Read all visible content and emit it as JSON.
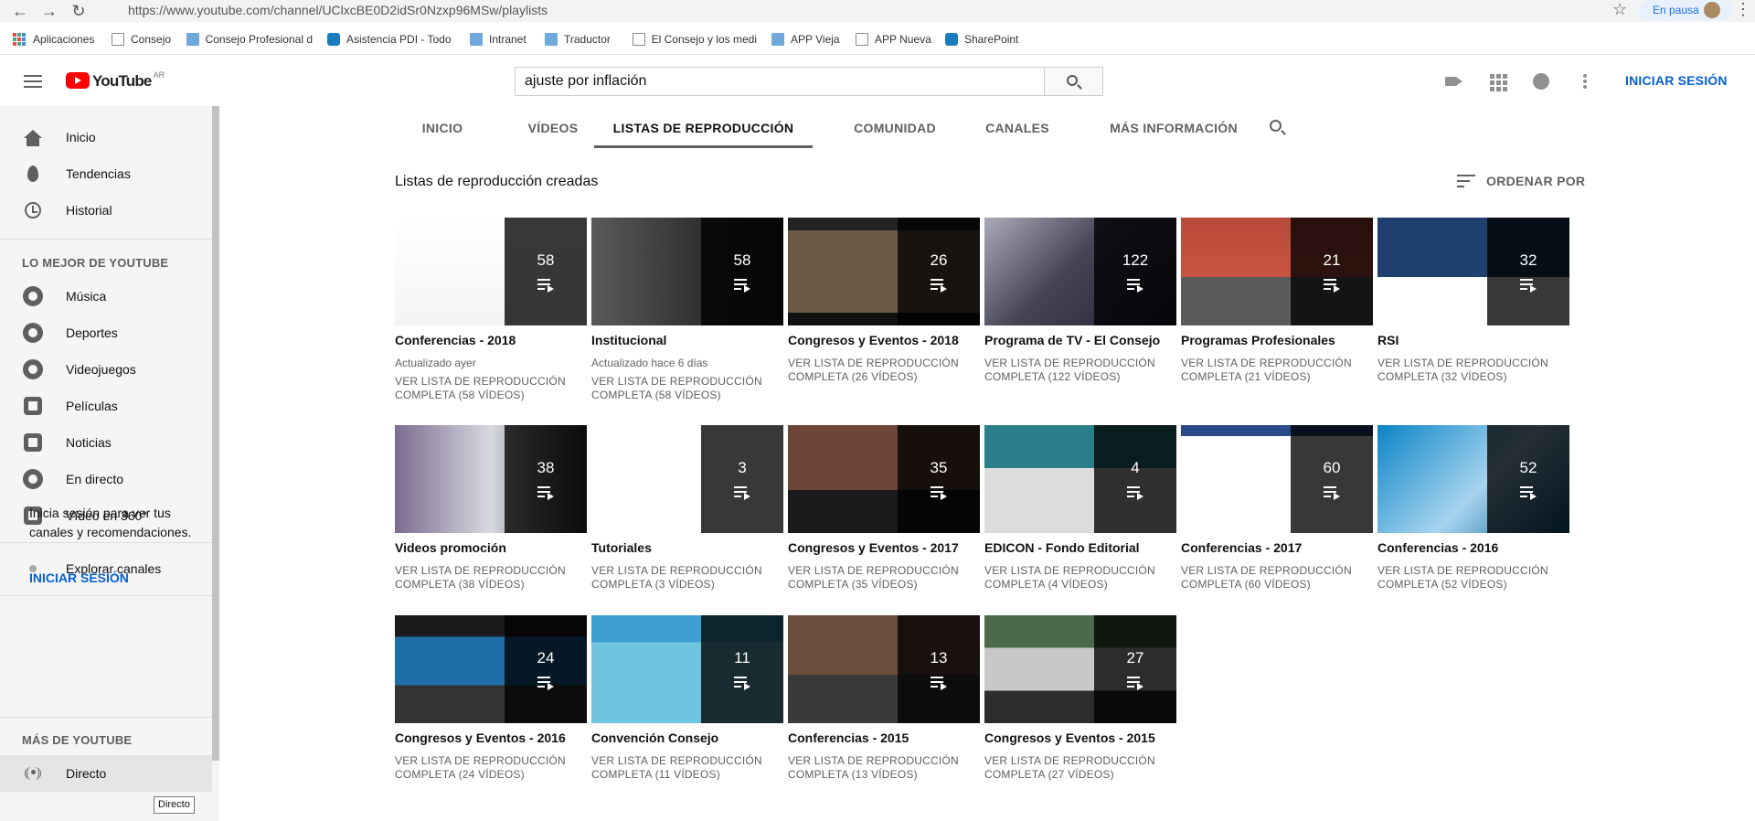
{
  "browser": {
    "url": "https://www.youtube.com/channel/UClxcBE0D2idSr0Nzxp96MSw/playlists",
    "paused_label": "En pausa",
    "bookmarks": [
      "Aplicaciones",
      "Consejo",
      "Consejo Profesional d",
      "Asistencia PDI - Todo",
      "Intranet",
      "Traductor",
      "El Consejo y los medi",
      "APP Vieja",
      "APP Nueva",
      "SharePoint"
    ]
  },
  "masthead": {
    "logo_text": "YouTube",
    "country_code": "AR",
    "search_value": "ajuste por inflación",
    "signin_label": "INICIAR SESIÓN"
  },
  "sidebar": {
    "main": [
      "Inicio",
      "Tendencias",
      "Historial"
    ],
    "best_heading": "LO MEJOR DE YOUTUBE",
    "best": [
      "Música",
      "Deportes",
      "Videojuegos",
      "Películas",
      "Noticias",
      "En directo",
      "Vídeo en 360°"
    ],
    "explore": "Explorar canales",
    "signin_prompt": "Inicia sesión para ver tus canales y recomendaciones.",
    "signin_link": "INICIAR SESIÓN",
    "more_heading": "MÁS DE YOUTUBE",
    "more": [
      "Directo"
    ],
    "tooltip": "Directo"
  },
  "tabs": [
    "INICIO",
    "VÍDEOS",
    "LISTAS DE REPRODUCCIÓN",
    "COMUNIDAD",
    "CANALES",
    "MÁS INFORMACIÓN"
  ],
  "section": {
    "title": "Listas de reproducción creadas",
    "sort_label": "ORDENAR POR"
  },
  "playlists": [
    {
      "title": "Conferencias - 2018",
      "count": "58",
      "updated": "Actualizado ayer",
      "link": "VER LISTA DE REPRODUCCIÓN COMPLETA (58 VÍDEOS)",
      "thumb": "t-slide"
    },
    {
      "title": "Institucional",
      "count": "58",
      "updated": "Actualizado hace 6 días",
      "link": "VER LISTA DE REPRODUCCIÓN COMPLETA (58 VÍDEOS)",
      "thumb": "t-people"
    },
    {
      "title": "Congresos y Eventos - 2018",
      "count": "26",
      "updated": "",
      "link": "VER LISTA DE REPRODUCCIÓN COMPLETA (26 VÍDEOS)",
      "thumb": "t-stage"
    },
    {
      "title": "Programa de TV - El Consejo",
      "count": "122",
      "updated": "",
      "link": "VER LISTA DE REPRODUCCIÓN COMPLETA (122 VÍDEOS)",
      "thumb": "t-tv"
    },
    {
      "title": "Programas Profesionales",
      "count": "21",
      "updated": "",
      "link": "VER LISTA DE REPRODUCCIÓN COMPLETA (21 VÍDEOS)",
      "thumb": "t-red"
    },
    {
      "title": "RSI",
      "count": "32",
      "updated": "",
      "link": "VER LISTA DE REPRODUCCIÓN COMPLETA (32 VÍDEOS)",
      "thumb": "t-blue"
    },
    {
      "title": "Videos promoción",
      "count": "38",
      "updated": "",
      "link": "VER LISTA DE REPRODUCCIÓN COMPLETA (38 VÍDEOS)",
      "thumb": "t-man"
    },
    {
      "title": "Tutoriales",
      "count": "3",
      "updated": "",
      "link": "VER LISTA DE REPRODUCCIÓN COMPLETA (3 VÍDEOS)",
      "thumb": "t-white"
    },
    {
      "title": "Congresos y Eventos - 2017",
      "count": "35",
      "updated": "",
      "link": "VER LISTA DE REPRODUCCIÓN COMPLETA (35 VÍDEOS)",
      "thumb": "t-panel"
    },
    {
      "title": "EDICON - Fondo Editorial",
      "count": "4",
      "updated": "",
      "link": "VER LISTA DE REPRODUCCIÓN COMPLETA (4 VÍDEOS)",
      "thumb": "t-edicon"
    },
    {
      "title": "Conferencias - 2017",
      "count": "60",
      "updated": "",
      "link": "VER LISTA DE REPRODUCCIÓN COMPLETA (60 VÍDEOS)",
      "thumb": "t-screen"
    },
    {
      "title": "Conferencias - 2016",
      "count": "52",
      "updated": "",
      "link": "VER LISTA DE REPRODUCCIÓN COMPLETA (52 VÍDEOS)",
      "thumb": "t-consejo"
    },
    {
      "title": "Congresos y Eventos - 2016",
      "count": "24",
      "updated": "",
      "link": "VER LISTA DE REPRODUCCIÓN COMPLETA (24 VÍDEOS)",
      "thumb": "t-dark"
    },
    {
      "title": "Convención Consejo",
      "count": "11",
      "updated": "",
      "link": "VER LISTA DE REPRODUCCIÓN COMPLETA (11 VÍDEOS)",
      "thumb": "t-conv"
    },
    {
      "title": "Conferencias - 2015",
      "count": "13",
      "updated": "",
      "link": "VER LISTA DE REPRODUCCIÓN COMPLETA (13 VÍDEOS)",
      "thumb": "t-old"
    },
    {
      "title": "Congresos y Eventos - 2015",
      "count": "27",
      "updated": "",
      "link": "VER LISTA DE REPRODUCCIÓN COMPLETA (27 VÍDEOS)",
      "thumb": "t-table"
    }
  ]
}
